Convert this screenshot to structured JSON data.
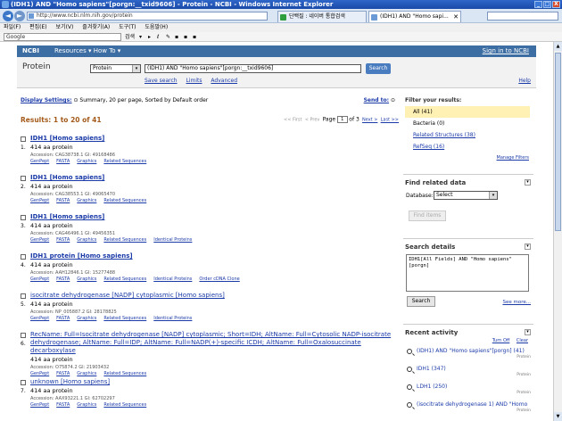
{
  "browser": {
    "title": "(IDH1) AND \"Homo sapiens\"[porgn:__txid9606] - Protein - NCBI - Windows Internet Explorer",
    "url": "http://www.ncbi.nlm.nih.gov/protein",
    "tab1": "단백질 : 네이버 통합검색",
    "tab2": "(IDH1) AND \"Homo sapi...",
    "menu": [
      "파일(F)",
      "편집(E)",
      "보기(V)",
      "즐겨찾기(A)",
      "도구(T)",
      "도움말(H)"
    ],
    "google_label": "Google",
    "toolbar_buttons": [
      "검색",
      "▾",
      "▸",
      "ℓ",
      "✎",
      "▪",
      "▪",
      "▪"
    ],
    "window_buttons": [
      "_",
      "□",
      "X"
    ],
    "tab_close": "✕"
  },
  "ncbi_bar": {
    "logo": "NCBI",
    "resources": "Resources ▾  How To ▾",
    "signin": "Sign in to NCBI"
  },
  "header": {
    "db_name": "Protein",
    "db_select": "Protein",
    "query": "(IDH1) AND \"Homo sapiens\"[porgn:__txid9606]",
    "search_btn": "Search",
    "links": [
      "Save search",
      "Limits",
      "Advanced"
    ],
    "help": "Help"
  },
  "display": {
    "settings_label": "Display Settings:",
    "settings_value": "Summary, 20 per page, Sorted by Default order",
    "send_to": "Send to:",
    "settings_toggle": "⊙",
    "sendto_toggle": "⊙"
  },
  "results": {
    "title": "Results: 1 to 20 of 41",
    "first": "<< First",
    "prev": "< Prev",
    "page_label": "Page",
    "page_value": "1",
    "of_label": "of 3",
    "next": "Next >",
    "last": "Last >>"
  },
  "items": [
    {
      "num": "1.",
      "title": "IDH1 [Homo sapiens]",
      "desc": "414 aa protein",
      "acc": "Accession: CAG38738.1  GI: 49168486",
      "links": [
        "GenPept",
        "FASTA",
        "Graphics",
        "Related Sequences"
      ]
    },
    {
      "num": "2.",
      "title": "IDH1 [Homo sapiens]",
      "desc": "414 aa protein",
      "acc": "Accession: CAG38553.1  GI: 49065470",
      "links": [
        "GenPept",
        "FASTA",
        "Graphics",
        "Related Sequences"
      ]
    },
    {
      "num": "3.",
      "title": "IDH1 [Homo sapiens]",
      "desc": "414 aa protein",
      "acc": "Accession: CAG46496.1  GI: 49456351",
      "links": [
        "GenPept",
        "FASTA",
        "Graphics",
        "Related Sequences",
        "Identical Proteins"
      ]
    },
    {
      "num": "4.",
      "title": "IDH1 protein [Homo sapiens]",
      "desc": "414 aa protein",
      "acc": "Accession: AAH12846.1  GI: 15277488",
      "links": [
        "GenPept",
        "FASTA",
        "Graphics",
        "Related Sequences",
        "Identical Proteins",
        "Order cDNA Clone"
      ]
    },
    {
      "num": "5.",
      "title": "isocitrate dehydrogenase [NADP] cytoplasmic [Homo sapiens]",
      "desc": "414 aa protein",
      "acc": "Accession: NP_005887.2  GI: 28178825",
      "links": [
        "GenPept",
        "FASTA",
        "Graphics",
        "Related Sequences",
        "Identical Proteins"
      ]
    },
    {
      "num": "6.",
      "title": "RecName: Full=Isocitrate dehydrogenase [NADP] cytoplasmic; Short=IDH; AltName: Full=Cytosolic NADP-isocitrate dehydrogenase; AltName: Full=IDP; AltName: Full=NADP(+)-specific ICDH; AltName: Full=Oxalosuccinate decarboxylase",
      "desc": "414 aa protein",
      "acc": "Accession: O75874.2  GI: 21903432",
      "links": [
        "GenPept",
        "FASTA",
        "Graphics",
        "Related Sequences"
      ]
    },
    {
      "num": "7.",
      "title": "unknown [Homo sapiens]",
      "desc": "414 aa protein",
      "acc": "Accession: AAX93221.1  GI: 62702297",
      "links": [
        "GenPept",
        "FASTA",
        "Graphics",
        "Related Sequences"
      ]
    }
  ],
  "sidebar": {
    "filter_title": "Filter your results:",
    "filters": [
      "All (41)",
      "Bacteria (0)",
      "Related Structures (38)",
      "RefSeq (16)"
    ],
    "manage": "Manage Filters",
    "related_title": "Find related data",
    "database_label": "Database:",
    "database_value": "Select",
    "find_btn": "Find items",
    "details_title": "Search details",
    "details_query": "IDH1[All Fields] AND \"Homo sapiens\"[porgn]",
    "details_search_btn": "Search",
    "see_more": "See more...",
    "activity_title": "Recent activity",
    "turn_off": "Turn Off",
    "clear": "Clear",
    "collapse": "▾",
    "activity": [
      {
        "label": "(IDH1) AND \"Homo sapiens\"[porgn] (41)",
        "type": "Protein"
      },
      {
        "label": "IDH1 (347)",
        "type": "Protein"
      },
      {
        "label": "LDH1 (250)",
        "type": "Protein"
      },
      {
        "label": "(isocitrate dehydrogenase 1) AND \"Homo",
        "type": "Protein"
      }
    ]
  },
  "select_arrow": "▾",
  "scroll_up": "▲",
  "scroll_down": "▼"
}
